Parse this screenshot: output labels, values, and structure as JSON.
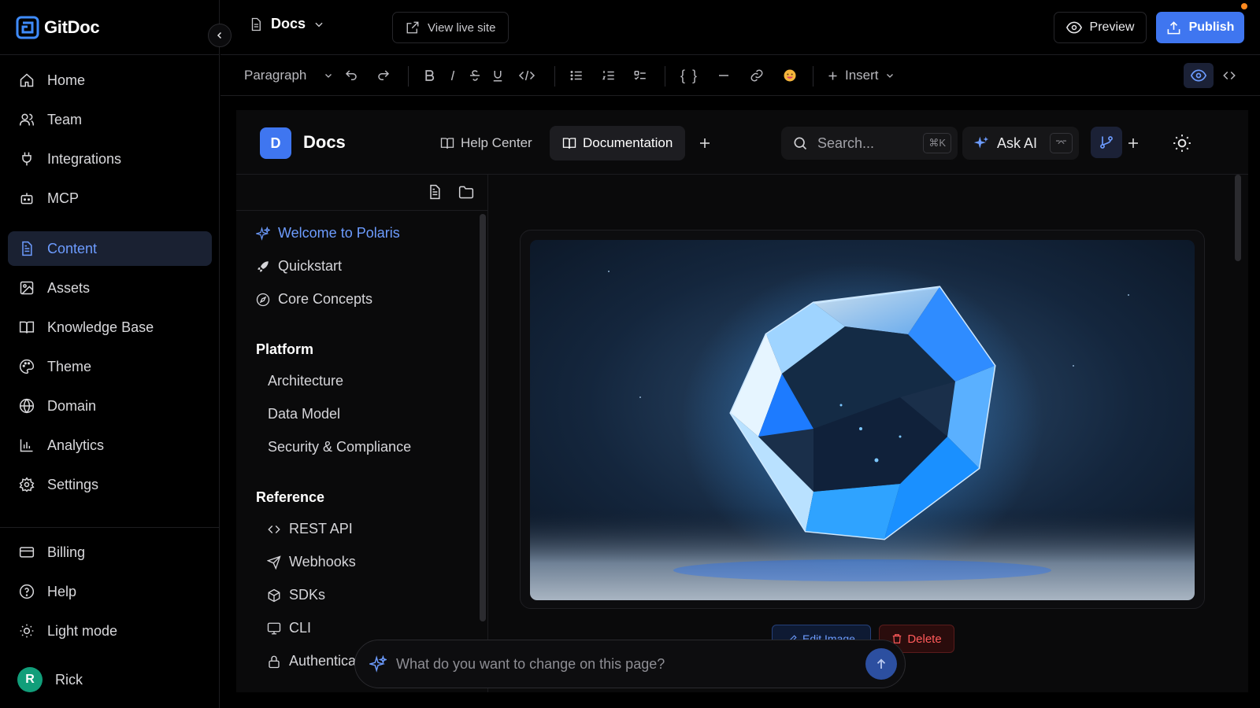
{
  "brand": {
    "name": "GitDoc"
  },
  "sidebar": {
    "nav": [
      {
        "label": "Home",
        "icon": "home-icon"
      },
      {
        "label": "Team",
        "icon": "users-icon"
      },
      {
        "label": "Integrations",
        "icon": "plug-icon"
      },
      {
        "label": "MCP",
        "icon": "bot-icon"
      }
    ],
    "nav2": [
      {
        "label": "Content",
        "icon": "file-text-icon",
        "active": true
      },
      {
        "label": "Assets",
        "icon": "image-icon"
      },
      {
        "label": "Knowledge Base",
        "icon": "book-icon"
      },
      {
        "label": "Theme",
        "icon": "palette-icon"
      },
      {
        "label": "Domain",
        "icon": "globe-icon"
      },
      {
        "label": "Analytics",
        "icon": "bar-chart-icon"
      },
      {
        "label": "Settings",
        "icon": "gear-icon"
      }
    ],
    "bottom": [
      {
        "label": "Billing",
        "icon": "credit-card-icon"
      },
      {
        "label": "Help",
        "icon": "help-circle-icon"
      },
      {
        "label": "Light mode",
        "icon": "sun-icon"
      }
    ],
    "user": {
      "initial": "R",
      "name": "Rick"
    }
  },
  "topbar": {
    "doc_switch": "Docs",
    "view_live": "View live site",
    "preview": "Preview",
    "publish": "Publish"
  },
  "toolbar": {
    "block_type": "Paragraph",
    "insert": "Insert",
    "code_block_glyph": "{ }"
  },
  "site": {
    "logo_letter": "D",
    "title": "Docs",
    "tabs": [
      {
        "label": "Help Center",
        "active": false
      },
      {
        "label": "Documentation",
        "active": true
      }
    ],
    "search_placeholder": "Search...",
    "search_shortcut": "⌘K",
    "ask_ai": "Ask AI",
    "ask_ai_shortcut": "⌤"
  },
  "doc_nav": {
    "top_items": [
      {
        "label": "Welcome to Polaris",
        "icon": "sparkle-icon",
        "active": true
      },
      {
        "label": "Quickstart",
        "icon": "rocket-icon"
      },
      {
        "label": "Core Concepts",
        "icon": "compass-icon"
      }
    ],
    "sections": [
      {
        "title": "Platform",
        "items": [
          "Architecture",
          "Data Model",
          "Security & Compliance"
        ]
      },
      {
        "title": "Reference",
        "items": [
          {
            "label": "REST API",
            "icon": "code-icon"
          },
          {
            "label": "Webhooks",
            "icon": "send-icon"
          },
          {
            "label": "SDKs",
            "icon": "package-icon"
          },
          {
            "label": "CLI",
            "icon": "monitor-icon"
          },
          {
            "label": "Authentication",
            "icon": "lock-icon"
          }
        ]
      }
    ]
  },
  "image_actions": {
    "edit": "Edit Image",
    "delete": "Delete"
  },
  "ai_prompt": {
    "placeholder": "What do you want to change on this page?"
  },
  "colors": {
    "accent": "#3f76f0",
    "active_text": "#6d9cff",
    "danger": "#ff5a5a",
    "notification": "#ff8a1f"
  }
}
